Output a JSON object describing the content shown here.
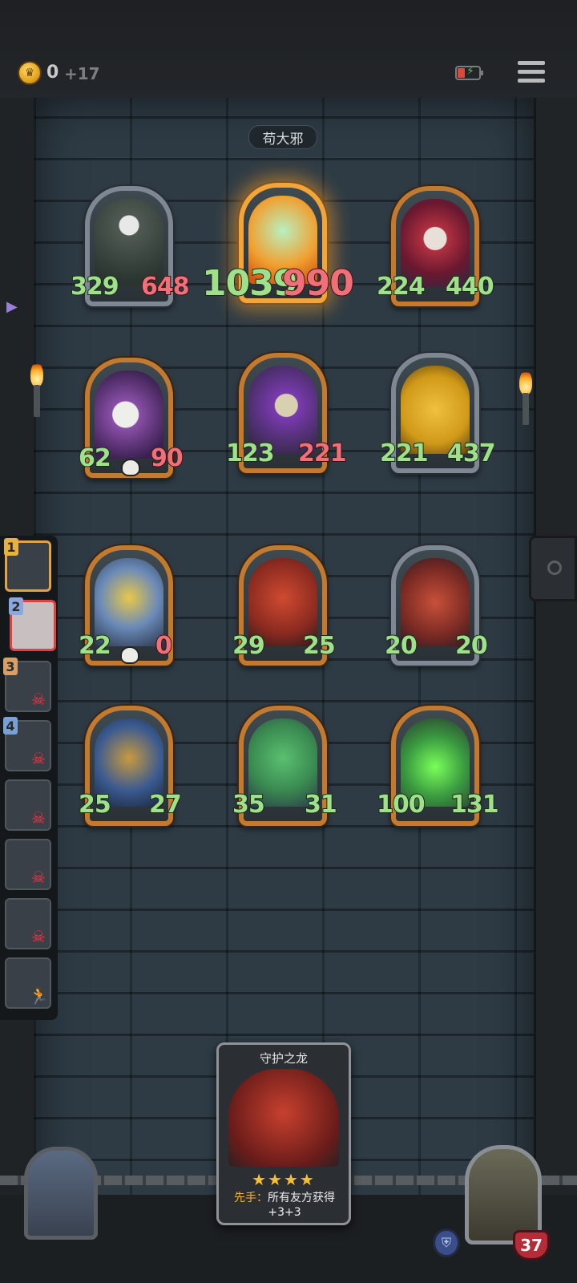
{
  "top_bar": {
    "gold": "0",
    "income": "+17",
    "icons": [
      "crown-coin-icon",
      "battery-icon",
      "menu-icon"
    ]
  },
  "enemy_name": "苟大邪",
  "enemy_units": [
    {
      "atk": "329",
      "hp": "648",
      "frame": "silver",
      "name": "necromancer"
    },
    {
      "atk": "1039",
      "hp": "990",
      "frame": "gold-glow",
      "name": "fire-spirit"
    },
    {
      "atk": "224",
      "hp": "440",
      "frame": "gold",
      "name": "jester"
    },
    {
      "atk": "62",
      "hp": "90",
      "frame": "gold",
      "name": "bone-dragon"
    },
    {
      "atk": "123",
      "hp": "221",
      "frame": "gold",
      "name": "purple-dragon"
    },
    {
      "atk": "221",
      "hp": "437",
      "frame": "silver",
      "name": "golden-dragon"
    }
  ],
  "player_units": [
    {
      "atk": "22",
      "hp": "0",
      "frame": "gold",
      "name": "blue-gold-dragon"
    },
    {
      "atk": "29",
      "hp": "25",
      "frame": "gold",
      "name": "red-dragon"
    },
    {
      "atk": "20",
      "hp": "20",
      "frame": "silver",
      "name": "guardian-dragon"
    },
    {
      "atk": "25",
      "hp": "27",
      "frame": "gold",
      "name": "armored-knight"
    },
    {
      "atk": "35",
      "hp": "31",
      "frame": "gold",
      "name": "frog-dragon"
    },
    {
      "atk": "100",
      "hp": "131",
      "frame": "gold",
      "name": "green-dragon"
    }
  ],
  "roster": [
    {
      "num": "1",
      "status": "active"
    },
    {
      "num": "2",
      "status": "selected"
    },
    {
      "num": "3",
      "status": "dead"
    },
    {
      "num": "4",
      "status": "dead"
    },
    {
      "num": "",
      "status": "dead"
    },
    {
      "num": "",
      "status": "dead"
    },
    {
      "num": "",
      "status": "dead"
    },
    {
      "num": "",
      "status": "dead"
    }
  ],
  "shop_card": {
    "title": "守护之龙",
    "stars": "★★★★",
    "keyword": "先手：",
    "desc_line1": "所有友方获得",
    "desc_line2": "+3+3"
  },
  "player": {
    "health": "37"
  },
  "colors": {
    "attack": "#9fe08a",
    "health": "#f0707a",
    "gold_frame": "#c17a2f",
    "silver_frame": "#7e8794",
    "board": "#2e3b45"
  }
}
